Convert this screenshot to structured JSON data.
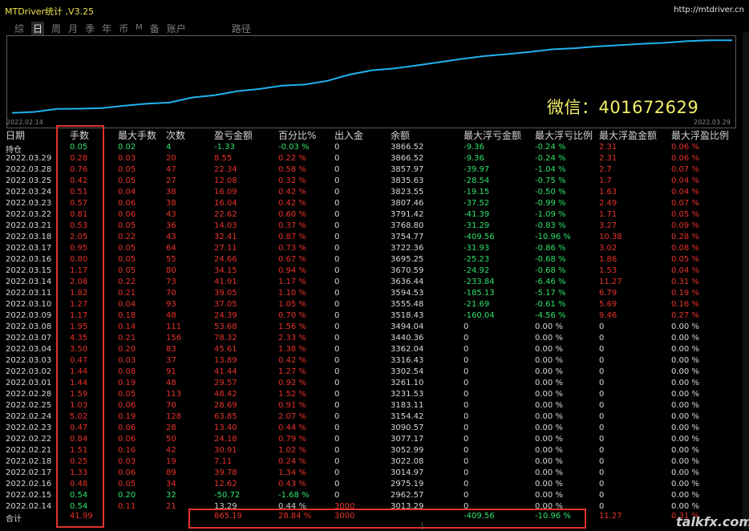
{
  "app": {
    "title": "MTDriver统计 ,V3.25",
    "link": "http://mtdriver.cn"
  },
  "tabs": [
    "综",
    "日",
    "周",
    "月",
    "季",
    "年",
    "币",
    "M",
    "备",
    "账户",
    "路径"
  ],
  "active_tab": "日",
  "chart": {
    "watermark_text": "微信：401672629",
    "start_date": "2022.02.14",
    "end_date": "2022.03.29",
    "line_color": "#1fb3f0",
    "balance_series": [
      2962.57,
      2975.19,
      3013.29,
      3014.97,
      3022.08,
      3052.99,
      3077.17,
      3090.57,
      3154.42,
      3183.11,
      3231.53,
      3261.1,
      3302.54,
      3316.43,
      3362.04,
      3440.36,
      3494.04,
      3518.43,
      3555.48,
      3594.53,
      3636.44,
      3670.59,
      3695.25,
      3722.36,
      3754.77,
      3768.8,
      3791.42,
      3807.46,
      3823.55,
      3835.63,
      3857.97,
      3866.52,
      3866.52
    ]
  },
  "headers": [
    "日期",
    "手数",
    "最大手数",
    "次数",
    "盈亏金额",
    "百分比%",
    "出入金",
    "余额",
    "最大浮亏金额",
    "最大浮亏比例",
    "最大浮盈金额",
    "最大浮盈比例"
  ],
  "rows": [
    {
      "c": [
        "持仓",
        "0.05",
        "0.02",
        "4",
        "-1.33",
        "-0.03 %",
        "0",
        "3866.52",
        "-9.36",
        "-0.24 %",
        "2.31",
        "0.06 %"
      ],
      "t": "hold"
    },
    {
      "c": [
        "2022.03.29",
        "0.28",
        "0.03",
        "20",
        "8.55",
        "0.22 %",
        "0",
        "3866.52",
        "-9.36",
        "-0.24 %",
        "2.31",
        "0.06 %"
      ],
      "t": "pos"
    },
    {
      "c": [
        "2022.03.28",
        "0.76",
        "0.05",
        "47",
        "22.34",
        "0.58 %",
        "0",
        "3857.97",
        "-39.97",
        "-1.04 %",
        "2.7",
        "0.07 %"
      ],
      "t": "pos"
    },
    {
      "c": [
        "2022.03.25",
        "0.42",
        "0.05",
        "27",
        "12.08",
        "0.32 %",
        "0",
        "3835.63",
        "-28.54",
        "-0.75 %",
        "1.7",
        "0.04 %"
      ],
      "t": "pos"
    },
    {
      "c": [
        "2022.03.24",
        "0.51",
        "0.04",
        "38",
        "16.09",
        "0.42 %",
        "0",
        "3823.55",
        "-19.15",
        "-0.50 %",
        "1.63",
        "0.04 %"
      ],
      "t": "pos"
    },
    {
      "c": [
        "2022.03.23",
        "0.57",
        "0.06",
        "38",
        "16.04",
        "0.42 %",
        "0",
        "3807.46",
        "-37.52",
        "-0.99 %",
        "2.49",
        "0.07 %"
      ],
      "t": "pos"
    },
    {
      "c": [
        "2022.03.22",
        "0.81",
        "0.06",
        "43",
        "22.62",
        "0.60 %",
        "0",
        "3791.42",
        "-41.39",
        "-1.09 %",
        "1.71",
        "0.05 %"
      ],
      "t": "pos"
    },
    {
      "c": [
        "2022.03.21",
        "0.53",
        "0.05",
        "36",
        "14.03",
        "0.37 %",
        "0",
        "3768.80",
        "-31.29",
        "-0.83 %",
        "3.27",
        "0.09 %"
      ],
      "t": "pos"
    },
    {
      "c": [
        "2022.03.18",
        "2.05",
        "0.22",
        "43",
        "32.41",
        "0.87 %",
        "0",
        "3754.77",
        "-409.56",
        "-10.96 %",
        "10.38",
        "0.28 %"
      ],
      "t": "pos"
    },
    {
      "c": [
        "2022.03.17",
        "0.95",
        "0.05",
        "64",
        "27.11",
        "0.73 %",
        "0",
        "3722.36",
        "-31.93",
        "-0.86 %",
        "3.02",
        "0.08 %"
      ],
      "t": "pos"
    },
    {
      "c": [
        "2022.03.16",
        "0.80",
        "0.05",
        "55",
        "24.66",
        "0.67 %",
        "0",
        "3695.25",
        "-25.23",
        "-0.68 %",
        "1.86",
        "0.05 %"
      ],
      "t": "pos"
    },
    {
      "c": [
        "2022.03.15",
        "1.17",
        "0.05",
        "80",
        "34.15",
        "0.94 %",
        "0",
        "3670.59",
        "-24.92",
        "-0.68 %",
        "1.53",
        "0.04 %"
      ],
      "t": "pos"
    },
    {
      "c": [
        "2022.03.14",
        "2.08",
        "0.22",
        "73",
        "41.91",
        "1.17 %",
        "0",
        "3636.44",
        "-233.84",
        "-6.46 %",
        "11.27",
        "0.31 %"
      ],
      "t": "pos"
    },
    {
      "c": [
        "2022.03.11",
        "1.82",
        "0.21",
        "70",
        "39.05",
        "1.10 %",
        "0",
        "3594.53",
        "-185.13",
        "-5.17 %",
        "6.79",
        "0.19 %"
      ],
      "t": "pos"
    },
    {
      "c": [
        "2022.03.10",
        "1.27",
        "0.04",
        "93",
        "37.05",
        "1.05 %",
        "0",
        "3555.48",
        "-21.69",
        "-0.61 %",
        "5.69",
        "0.16 %"
      ],
      "t": "pos"
    },
    {
      "c": [
        "2022.03.09",
        "1.17",
        "0.18",
        "48",
        "24.39",
        "0.70 %",
        "0",
        "3518.43",
        "-160.04",
        "-4.56 %",
        "9.46",
        "0.27 %"
      ],
      "t": "pos"
    },
    {
      "c": [
        "2022.03.08",
        "1.95",
        "0.14",
        "111",
        "53.68",
        "1.56 %",
        "0",
        "3494.04",
        "0",
        "0.00 %",
        "0",
        "0.00 %"
      ],
      "t": "pos"
    },
    {
      "c": [
        "2022.03.07",
        "4.35",
        "0.21",
        "156",
        "78.32",
        "2.33 %",
        "0",
        "3440.36",
        "0",
        "0.00 %",
        "0",
        "0.00 %"
      ],
      "t": "pos"
    },
    {
      "c": [
        "2022.03.04",
        "3.50",
        "0.20",
        "83",
        "45.61",
        "1.38 %",
        "0",
        "3362.04",
        "0",
        "0.00 %",
        "0",
        "0.00 %"
      ],
      "t": "pos"
    },
    {
      "c": [
        "2022.03.03",
        "0.47",
        "0.03",
        "37",
        "13.89",
        "0.42 %",
        "0",
        "3316.43",
        "0",
        "0.00 %",
        "0",
        "0.00 %"
      ],
      "t": "pos"
    },
    {
      "c": [
        "2022.03.02",
        "1.44",
        "0.08",
        "91",
        "41.44",
        "1.27 %",
        "0",
        "3302.54",
        "0",
        "0.00 %",
        "0",
        "0.00 %"
      ],
      "t": "pos"
    },
    {
      "c": [
        "2022.03.01",
        "1.44",
        "0.19",
        "48",
        "29.57",
        "0.92 %",
        "0",
        "3261.10",
        "0",
        "0.00 %",
        "0",
        "0.00 %"
      ],
      "t": "pos"
    },
    {
      "c": [
        "2022.02.28",
        "1.59",
        "0.05",
        "113",
        "48.42",
        "1.52 %",
        "0",
        "3231.53",
        "0",
        "0.00 %",
        "0",
        "0.00 %"
      ],
      "t": "pos"
    },
    {
      "c": [
        "2022.02.25",
        "1.03",
        "0.06",
        "70",
        "28.69",
        "0.91 %",
        "0",
        "3183.11",
        "0",
        "0.00 %",
        "0",
        "0.00 %"
      ],
      "t": "pos"
    },
    {
      "c": [
        "2022.02.24",
        "5.02",
        "0.19",
        "128",
        "63.85",
        "2.07 %",
        "0",
        "3154.42",
        "0",
        "0.00 %",
        "0",
        "0.00 %"
      ],
      "t": "pos"
    },
    {
      "c": [
        "2022.02.23",
        "0.47",
        "0.06",
        "28",
        "13.40",
        "0.44 %",
        "0",
        "3090.57",
        "0",
        "0.00 %",
        "0",
        "0.00 %"
      ],
      "t": "pos"
    },
    {
      "c": [
        "2022.02.22",
        "0.84",
        "0.06",
        "50",
        "24.18",
        "0.79 %",
        "0",
        "3077.17",
        "0",
        "0.00 %",
        "0",
        "0.00 %"
      ],
      "t": "pos"
    },
    {
      "c": [
        "2022.02.21",
        "1.51",
        "0.16",
        "42",
        "30.91",
        "1.02 %",
        "0",
        "3052.99",
        "0",
        "0.00 %",
        "0",
        "0.00 %"
      ],
      "t": "pos"
    },
    {
      "c": [
        "2022.02.18",
        "0.25",
        "0.03",
        "19",
        "7.11",
        "0.24 %",
        "0",
        "3022.08",
        "0",
        "0.00 %",
        "0",
        "0.00 %"
      ],
      "t": "pos"
    },
    {
      "c": [
        "2022.02.17",
        "1.33",
        "0.06",
        "89",
        "39.78",
        "1.34 %",
        "0",
        "3014.97",
        "0",
        "0.00 %",
        "0",
        "0.00 %"
      ],
      "t": "pos"
    },
    {
      "c": [
        "2022.02.16",
        "0.48",
        "0.05",
        "34",
        "12.62",
        "0.43 %",
        "0",
        "2975.19",
        "0",
        "0.00 %",
        "0",
        "0.00 %"
      ],
      "t": "pos"
    },
    {
      "c": [
        "2022.02.15",
        "0.54",
        "0.20",
        "32",
        "-50.72",
        "-1.68 %",
        "0",
        "2962.57",
        "0",
        "0.00 %",
        "0",
        "0.00 %"
      ],
      "t": "neg"
    },
    {
      "c": [
        "2022.02.14",
        "0.54",
        "0.11",
        "21",
        "13.29",
        "0.44 %",
        "3000",
        "3013.29",
        "0",
        "0.00 %",
        "0",
        "0.00 %"
      ],
      "t": "first"
    }
  ],
  "total": {
    "label": "合计",
    "lots": "41.99",
    "pnl": "865.19",
    "pct": "28.84 %",
    "deposit": "3000",
    "max_float_loss": "-409.56",
    "max_float_loss_pct": "-10.96 %",
    "max_float_profit": "11.27",
    "max_float_profit_pct": "0.31 %"
  },
  "site_watermark": "talkfx.com",
  "colors": {
    "profit": "#e8322a",
    "loss": "#2fe36b",
    "highlight": "#e2332b"
  }
}
